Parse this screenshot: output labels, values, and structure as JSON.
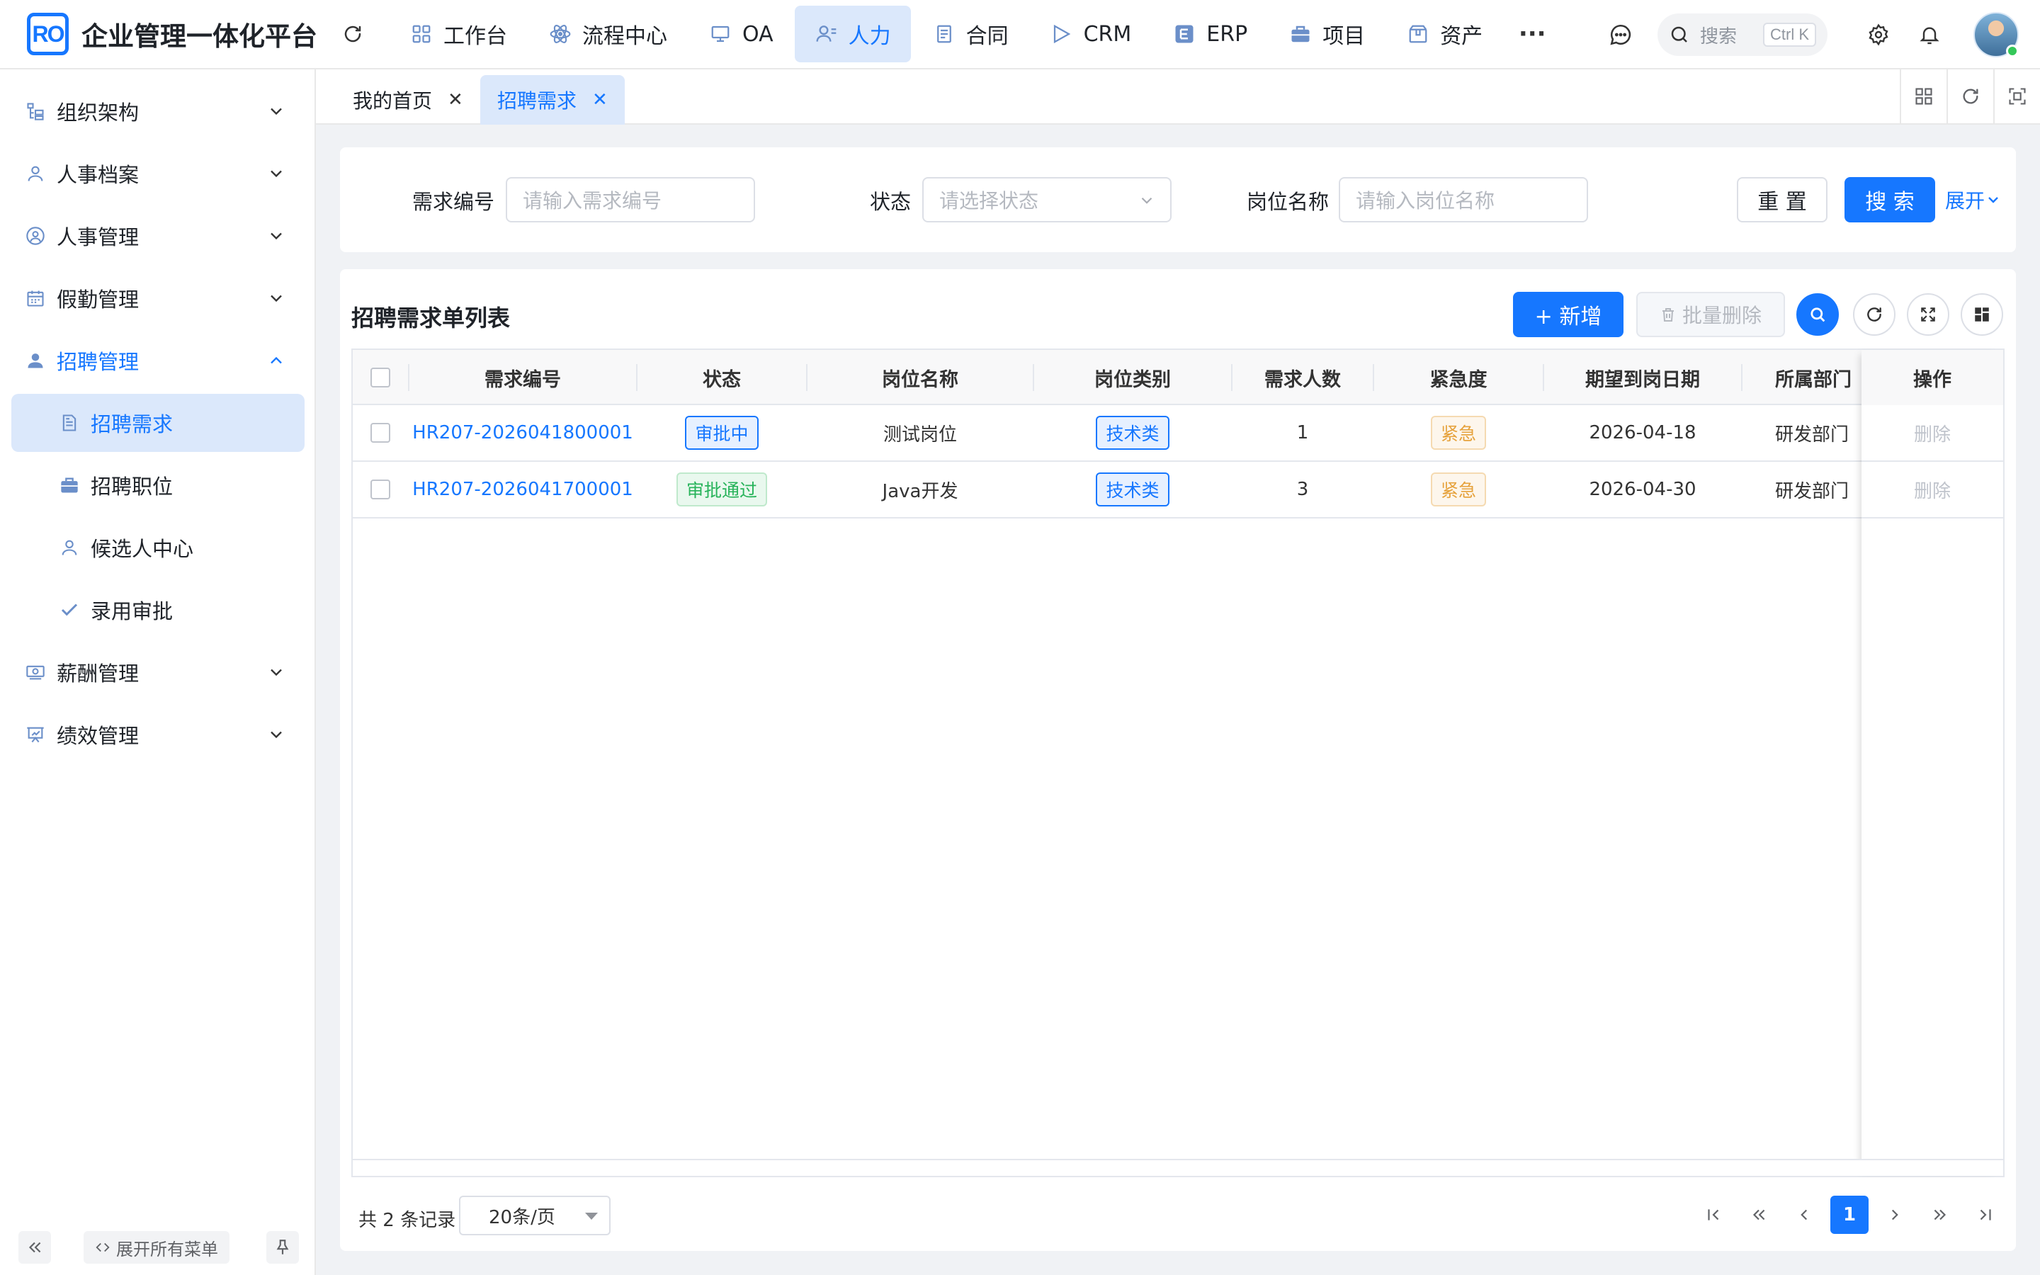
{
  "header": {
    "logo_text": "RO",
    "title": "企业管理一体化平台",
    "nav": [
      {
        "label": "工作台",
        "icon": "grid-icon"
      },
      {
        "label": "流程中心",
        "icon": "atom-icon"
      },
      {
        "label": "OA",
        "icon": "monitor-icon"
      },
      {
        "label": "人力",
        "icon": "user-list-icon",
        "active": true
      },
      {
        "label": "合同",
        "icon": "document-icon"
      },
      {
        "label": "CRM",
        "icon": "triangle-icon"
      },
      {
        "label": "ERP",
        "icon": "erp-badge-icon"
      },
      {
        "label": "项目",
        "icon": "briefcase-icon"
      },
      {
        "label": "资产",
        "icon": "package-icon"
      }
    ],
    "search_placeholder": "搜索",
    "search_shortcut": "Ctrl K"
  },
  "sidebar": {
    "items": [
      {
        "label": "组织架构"
      },
      {
        "label": "人事档案"
      },
      {
        "label": "人事管理"
      },
      {
        "label": "假勤管理"
      },
      {
        "label": "招聘管理",
        "open": true
      },
      {
        "label": "招聘需求",
        "selected": true
      },
      {
        "label": "招聘职位"
      },
      {
        "label": "候选人中心"
      },
      {
        "label": "录用审批"
      },
      {
        "label": "薪酬管理"
      },
      {
        "label": "绩效管理"
      }
    ],
    "expand_all_label": "展开所有菜单"
  },
  "tabs": [
    {
      "label": "我的首页",
      "active": false
    },
    {
      "label": "招聘需求",
      "active": true
    }
  ],
  "filter": {
    "fields": [
      {
        "label": "需求编号",
        "placeholder": "请输入需求编号"
      },
      {
        "label": "状态",
        "placeholder": "请选择状态"
      },
      {
        "label": "岗位名称",
        "placeholder": "请输入岗位名称"
      }
    ],
    "reset_label": "重 置",
    "search_label": "搜 索",
    "expand_label": "展开"
  },
  "table": {
    "title": "招聘需求单列表",
    "add_label": "+ 新增",
    "batch_delete_label": "批量删除",
    "columns": [
      "需求编号",
      "状态",
      "岗位名称",
      "岗位类别",
      "需求人数",
      "紧急度",
      "期望到岗日期",
      "所属部门",
      "操作"
    ],
    "rows": [
      {
        "code": "HR207-2026041800001",
        "status": "审批中",
        "status_type": "processing",
        "position": "测试岗位",
        "category": "技术类",
        "headcount": "1",
        "urgency": "紧急",
        "date": "2026-04-18",
        "dept": "研发部门",
        "action": "删除"
      },
      {
        "code": "HR207-2026041700001",
        "status": "审批通过",
        "status_type": "approved",
        "position": "Java开发",
        "category": "技术类",
        "headcount": "3",
        "urgency": "紧急",
        "date": "2026-04-30",
        "dept": "研发部门",
        "action": "删除"
      }
    ]
  },
  "pagination": {
    "total_text": "共 2 条记录",
    "page_size": "20条/页",
    "current_page": "1"
  },
  "colors": {
    "primary": "#1677ff",
    "active_bg": "#dbe8fb",
    "success": "#27b35a",
    "warning": "#e6a23c"
  }
}
